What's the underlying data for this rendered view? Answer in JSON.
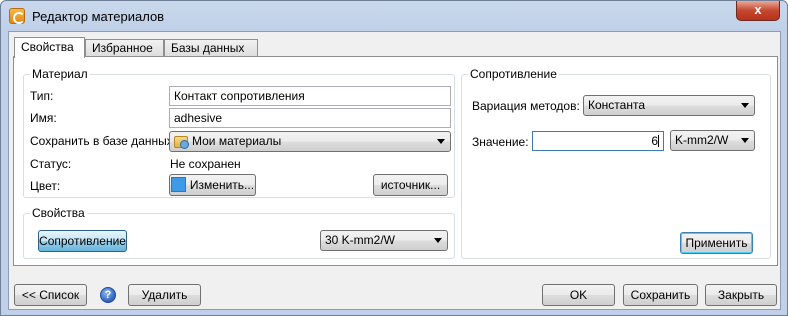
{
  "window": {
    "title": "Редактор материалов",
    "close_label": "x"
  },
  "tabs": [
    {
      "label": "Свойства",
      "active": true
    },
    {
      "label": "Избранное",
      "active": false
    },
    {
      "label": "Базы данных",
      "active": false
    }
  ],
  "material": {
    "group_title": "Материал",
    "type_label": "Тип:",
    "type_value": "Контакт сопротивления",
    "name_label": "Имя:",
    "name_value": "adhesive",
    "save_db_label": "Сохранить в базе данных:",
    "save_db_value": "Мои материалы",
    "save_db_icon": "database-folder-icon",
    "status_label": "Статус:",
    "status_value": "Не сохранен",
    "color_label": "Цвет:",
    "color_button_label": "Изменить...",
    "color_swatch": "#3e9ae6",
    "source_button_label": "источник..."
  },
  "properties": {
    "group_title": "Свойства",
    "resistance_button_label": "Сопротивление",
    "value_select": "30 K-mm2/W"
  },
  "resistance": {
    "group_title": "Сопротивление",
    "method_label": "Вариация методов:",
    "method_value": "Константа",
    "value_label": "Значение:",
    "value_input": "6",
    "unit_value": "K-mm2/W",
    "apply_button_label": "Применить"
  },
  "footer": {
    "list_button_label": "<< Список",
    "help_icon": "help-icon",
    "delete_button_label": "Удалить",
    "ok_button_label": "OK",
    "save_button_label": "Сохранить",
    "close_button_label": "Закрыть"
  }
}
